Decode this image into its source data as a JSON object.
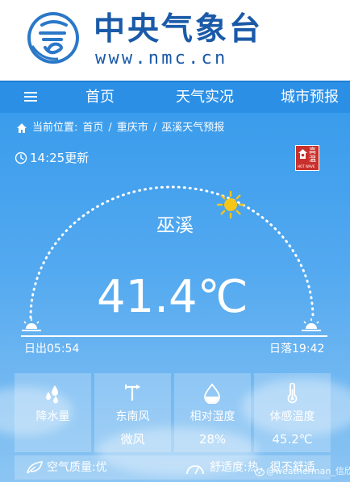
{
  "brand": {
    "title": "中央气象台",
    "url": "www.nmc.cn"
  },
  "nav": {
    "items": [
      "首页",
      "天气实况",
      "城市预报"
    ]
  },
  "breadcrumb": {
    "label": "当前位置:",
    "items": [
      "首页",
      "重庆市",
      "巫溪天气预报"
    ]
  },
  "update": "14:25更新",
  "warning": {
    "line1": "高",
    "line2": "温",
    "tiny": "HOT WAVE",
    "color": "#c9302c"
  },
  "city": "巫溪",
  "temperature": "41.4℃",
  "sunrise": "日出05:54",
  "sunset": "日落19:42",
  "tiles": [
    {
      "icon": "raindrops-icon",
      "label": "降水量",
      "value": ""
    },
    {
      "icon": "wind-vane-icon",
      "label": "东南风",
      "value": "微风"
    },
    {
      "icon": "humidity-drop-icon",
      "label": "相对湿度",
      "value": "28%"
    },
    {
      "icon": "thermometer-icon",
      "label": "体感温度",
      "value": "45.2℃"
    }
  ],
  "air_quality": "空气质量:优",
  "comfort": "舒适度:热，很不舒适",
  "watermark": "@weatherman_信欣",
  "colors": {
    "brand": "#1a5aa8",
    "nav": "#2b8fe6",
    "sky_top": "#3a9cec",
    "sun": "#f5c518"
  }
}
